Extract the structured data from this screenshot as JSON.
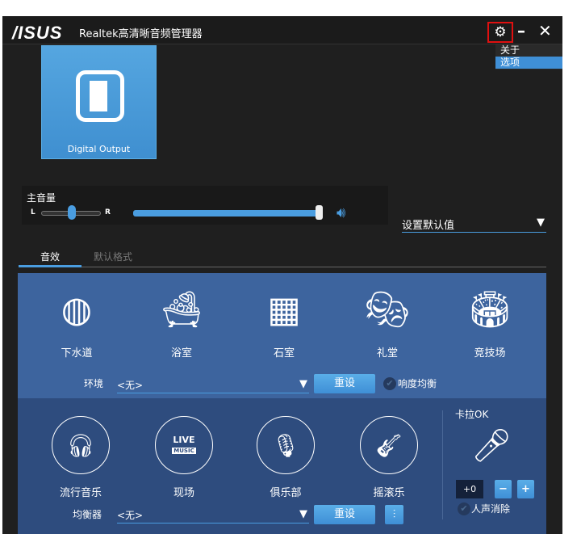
{
  "titlebar": {
    "logo": "/ISUS",
    "title": "Realtek高清晰音频管理器",
    "gear": "⚙",
    "minimize": "–",
    "close": "✕"
  },
  "menu": {
    "items": [
      "关于",
      "选项"
    ],
    "selected": "选项"
  },
  "device": {
    "label": "Digital Output"
  },
  "volume": {
    "label": "主音量",
    "left": "L",
    "right": "R",
    "balance_percent": 50,
    "level_percent": 100
  },
  "default_select": {
    "value": "设置默认值"
  },
  "tabs": [
    {
      "label": "音效",
      "active": true
    },
    {
      "label": "默认格式",
      "active": false
    }
  ],
  "environments": [
    {
      "label": "下水道",
      "icon": "sewer-icon"
    },
    {
      "label": "浴室",
      "icon": "bathtub-icon"
    },
    {
      "label": "石室",
      "icon": "stone-room-icon"
    },
    {
      "label": "礼堂",
      "icon": "auditorium-icon"
    },
    {
      "label": "竞技场",
      "icon": "arena-icon"
    }
  ],
  "env_row": {
    "label": "环境",
    "value": "<无>",
    "reset": "重设",
    "loudness": "响度均衡"
  },
  "equalizers": [
    {
      "label": "流行音乐",
      "icon": "headphones-icon"
    },
    {
      "label": "现场",
      "icon": "live-music-icon",
      "badge1": "LIVE",
      "badge2": "MUSIC"
    },
    {
      "label": "俱乐部",
      "icon": "microphone-icon"
    },
    {
      "label": "摇滚乐",
      "icon": "guitar-icon"
    }
  ],
  "eq_row": {
    "label": "均衡器",
    "value": "<无>",
    "reset": "重设"
  },
  "karaoke": {
    "label": "卡拉OK",
    "value": "+0",
    "minus": "−",
    "plus": "+",
    "vocal": "人声消除"
  },
  "colors": {
    "accent": "#3f8fd6",
    "upper": "#3d649e",
    "lower": "#2e4c7e"
  }
}
